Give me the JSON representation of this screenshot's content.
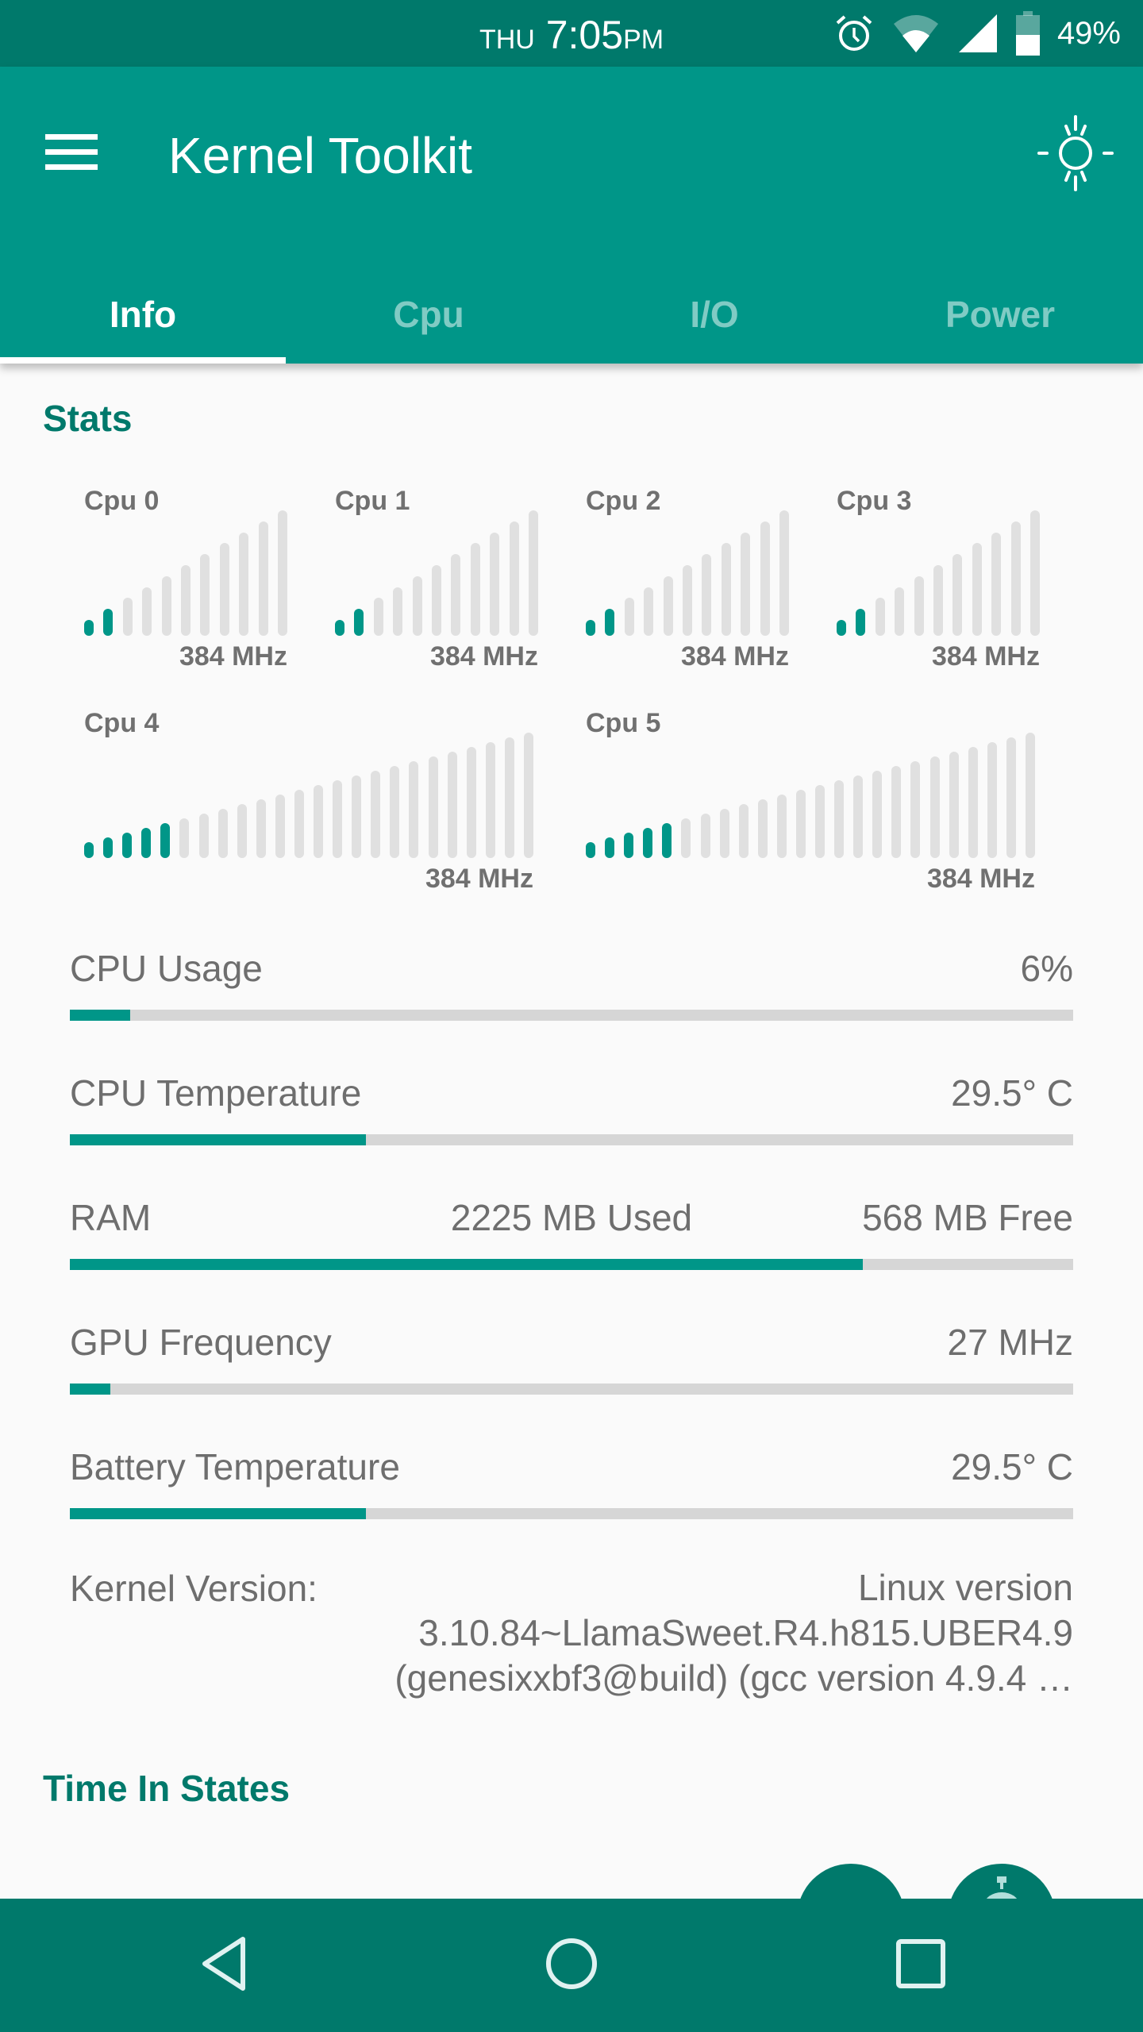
{
  "status_bar": {
    "day": "THU",
    "time": "7:05",
    "ampm": "PM",
    "battery_percent": "49%",
    "icons": [
      "alarm-icon",
      "wifi-icon",
      "cell-signal-icon",
      "battery-icon"
    ]
  },
  "app_bar": {
    "title": "Kernel Toolkit",
    "menu_icon": "hamburger-menu-icon",
    "theme_icon": "brightness-sun-icon"
  },
  "tabs": [
    {
      "label": "Info",
      "active": true
    },
    {
      "label": "Cpu",
      "active": false
    },
    {
      "label": "I/O",
      "active": false
    },
    {
      "label": "Power",
      "active": false
    }
  ],
  "stats": {
    "title": "Stats",
    "cpus": [
      {
        "label": "Cpu 0",
        "freq": "384 MHz",
        "total_steps": 11,
        "active_steps": 2
      },
      {
        "label": "Cpu 1",
        "freq": "384 MHz",
        "total_steps": 11,
        "active_steps": 2
      },
      {
        "label": "Cpu 2",
        "freq": "384 MHz",
        "total_steps": 11,
        "active_steps": 2
      },
      {
        "label": "Cpu 3",
        "freq": "384 MHz",
        "total_steps": 11,
        "active_steps": 2
      },
      {
        "label": "Cpu 4",
        "freq": "384 MHz",
        "total_steps": 24,
        "active_steps": 5
      },
      {
        "label": "Cpu 5",
        "freq": "384 MHz",
        "total_steps": 24,
        "active_steps": 5
      }
    ],
    "rows": [
      {
        "label": "CPU Usage",
        "mid": "",
        "value": "6%",
        "progress": 0.06
      },
      {
        "label": "CPU Temperature",
        "mid": "",
        "value": "29.5° C",
        "progress": 0.295
      },
      {
        "label": "RAM",
        "mid": "2225 MB Used",
        "value": "568 MB Free",
        "progress": 0.79
      },
      {
        "label": "GPU Frequency",
        "mid": "",
        "value": "27 MHz",
        "progress": 0.04
      },
      {
        "label": "Battery Temperature",
        "mid": "",
        "value": "29.5° C",
        "progress": 0.295
      }
    ],
    "kernel": {
      "label": "Kernel Version:",
      "value": "Linux version 3.10.84~LlamaSweet.R4.h815.UBER4.9 (genesixxbf3@build) (gcc version 4.9.4 …"
    }
  },
  "time_in_states": {
    "title": "Time In States"
  },
  "fabs": [
    {
      "icon": "refresh-icon"
    },
    {
      "icon": "stopwatch-icon"
    }
  ],
  "nav_bar": {
    "back_icon": "back-triangle-icon",
    "home_icon": "home-circle-icon",
    "recents_icon": "recents-square-icon"
  },
  "colors": {
    "primary": "#009688",
    "primary_dark": "#00796b",
    "track": "#d6d6d6",
    "bar_inactive": "#e0e0e0",
    "text": "#6e6e6e"
  }
}
